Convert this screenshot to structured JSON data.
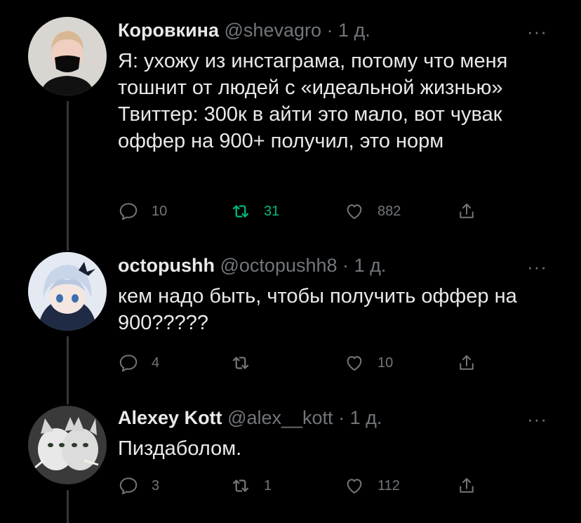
{
  "tweets": [
    {
      "name": "Коровкина",
      "handle": "@shevagro",
      "dot": "·",
      "time": "1 д.",
      "text": "Я: ухожу из инстаграма, потому что меня тошнит от людей с «идеальной жизнью»\nТвиттер: 300к в айти это мало, вот чувак оффер на 900+ получил, это норм",
      "replies": "10",
      "retweets": "31",
      "likes": "882",
      "retweeted": true,
      "avatar": "woman-in-black-mask"
    },
    {
      "name": "octopushh",
      "handle": "@octopushh8",
      "dot": "·",
      "time": "1 д.",
      "text": "кем надо быть, чтобы получить оффер на 900?????",
      "replies": "4",
      "retweets": "",
      "likes": "10",
      "retweeted": false,
      "avatar": "anime-character"
    },
    {
      "name": "Alexey Kott",
      "handle": "@alex__kott",
      "dot": "·",
      "time": "1 д.",
      "text": "Пиздаболом.",
      "replies": "3",
      "retweets": "1",
      "likes": "112",
      "retweeted": false,
      "avatar": "two-headed-cat"
    }
  ],
  "more_label": "···",
  "colors": {
    "background": "#000000",
    "text": "#e7e9ea",
    "muted": "#71767b",
    "retweet": "#00ba7c",
    "line": "#333639"
  }
}
